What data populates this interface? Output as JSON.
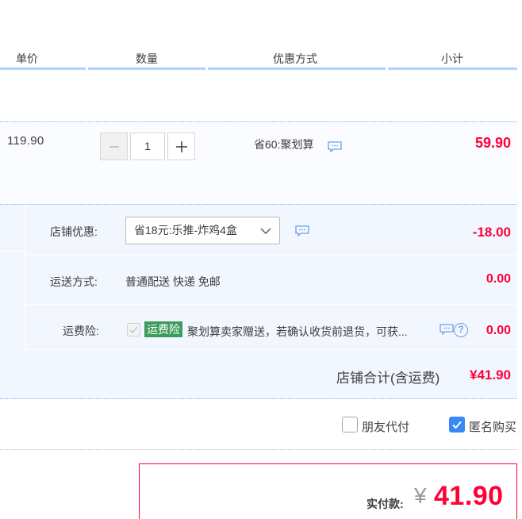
{
  "header": {
    "col_price": "单价",
    "col_qty": "数量",
    "col_promo": "优惠方式",
    "col_subtotal": "小计"
  },
  "item": {
    "unit_price": "119.90",
    "quantity": "1",
    "promo_text": "省60:聚划算",
    "subtotal": "59.90"
  },
  "shop": {
    "discount_label": "店铺优惠:",
    "discount_selected": "省18元:乐推-炸鸡4盒",
    "discount_amount": "-18.00",
    "shipping_label": "运送方式:",
    "shipping_value": "普通配送 快递 免邮",
    "shipping_amount": "0.00",
    "insurance_label": "运费险:",
    "insurance_tag": "运费险",
    "insurance_desc": "聚划算卖家赠送，若确认收货前退货，可获...",
    "insurance_amount": "0.00",
    "insurance_help": "?",
    "total_label": "店铺合计(含运费)",
    "total_value": "¥41.90"
  },
  "options": {
    "friend_pay": "朋友代付",
    "friend_pay_checked": false,
    "anonymous": "匿名购买",
    "anonymous_checked": true
  },
  "payment": {
    "label": "实付款:",
    "currency": "¥",
    "amount": "41.90"
  },
  "colors": {
    "accent_red": "#ff0036",
    "header_line": "#b2d1ff",
    "shop_bg": "#f2f7ff",
    "check_blue": "#3a87f8",
    "insurance_green": "#3c9c5a"
  }
}
